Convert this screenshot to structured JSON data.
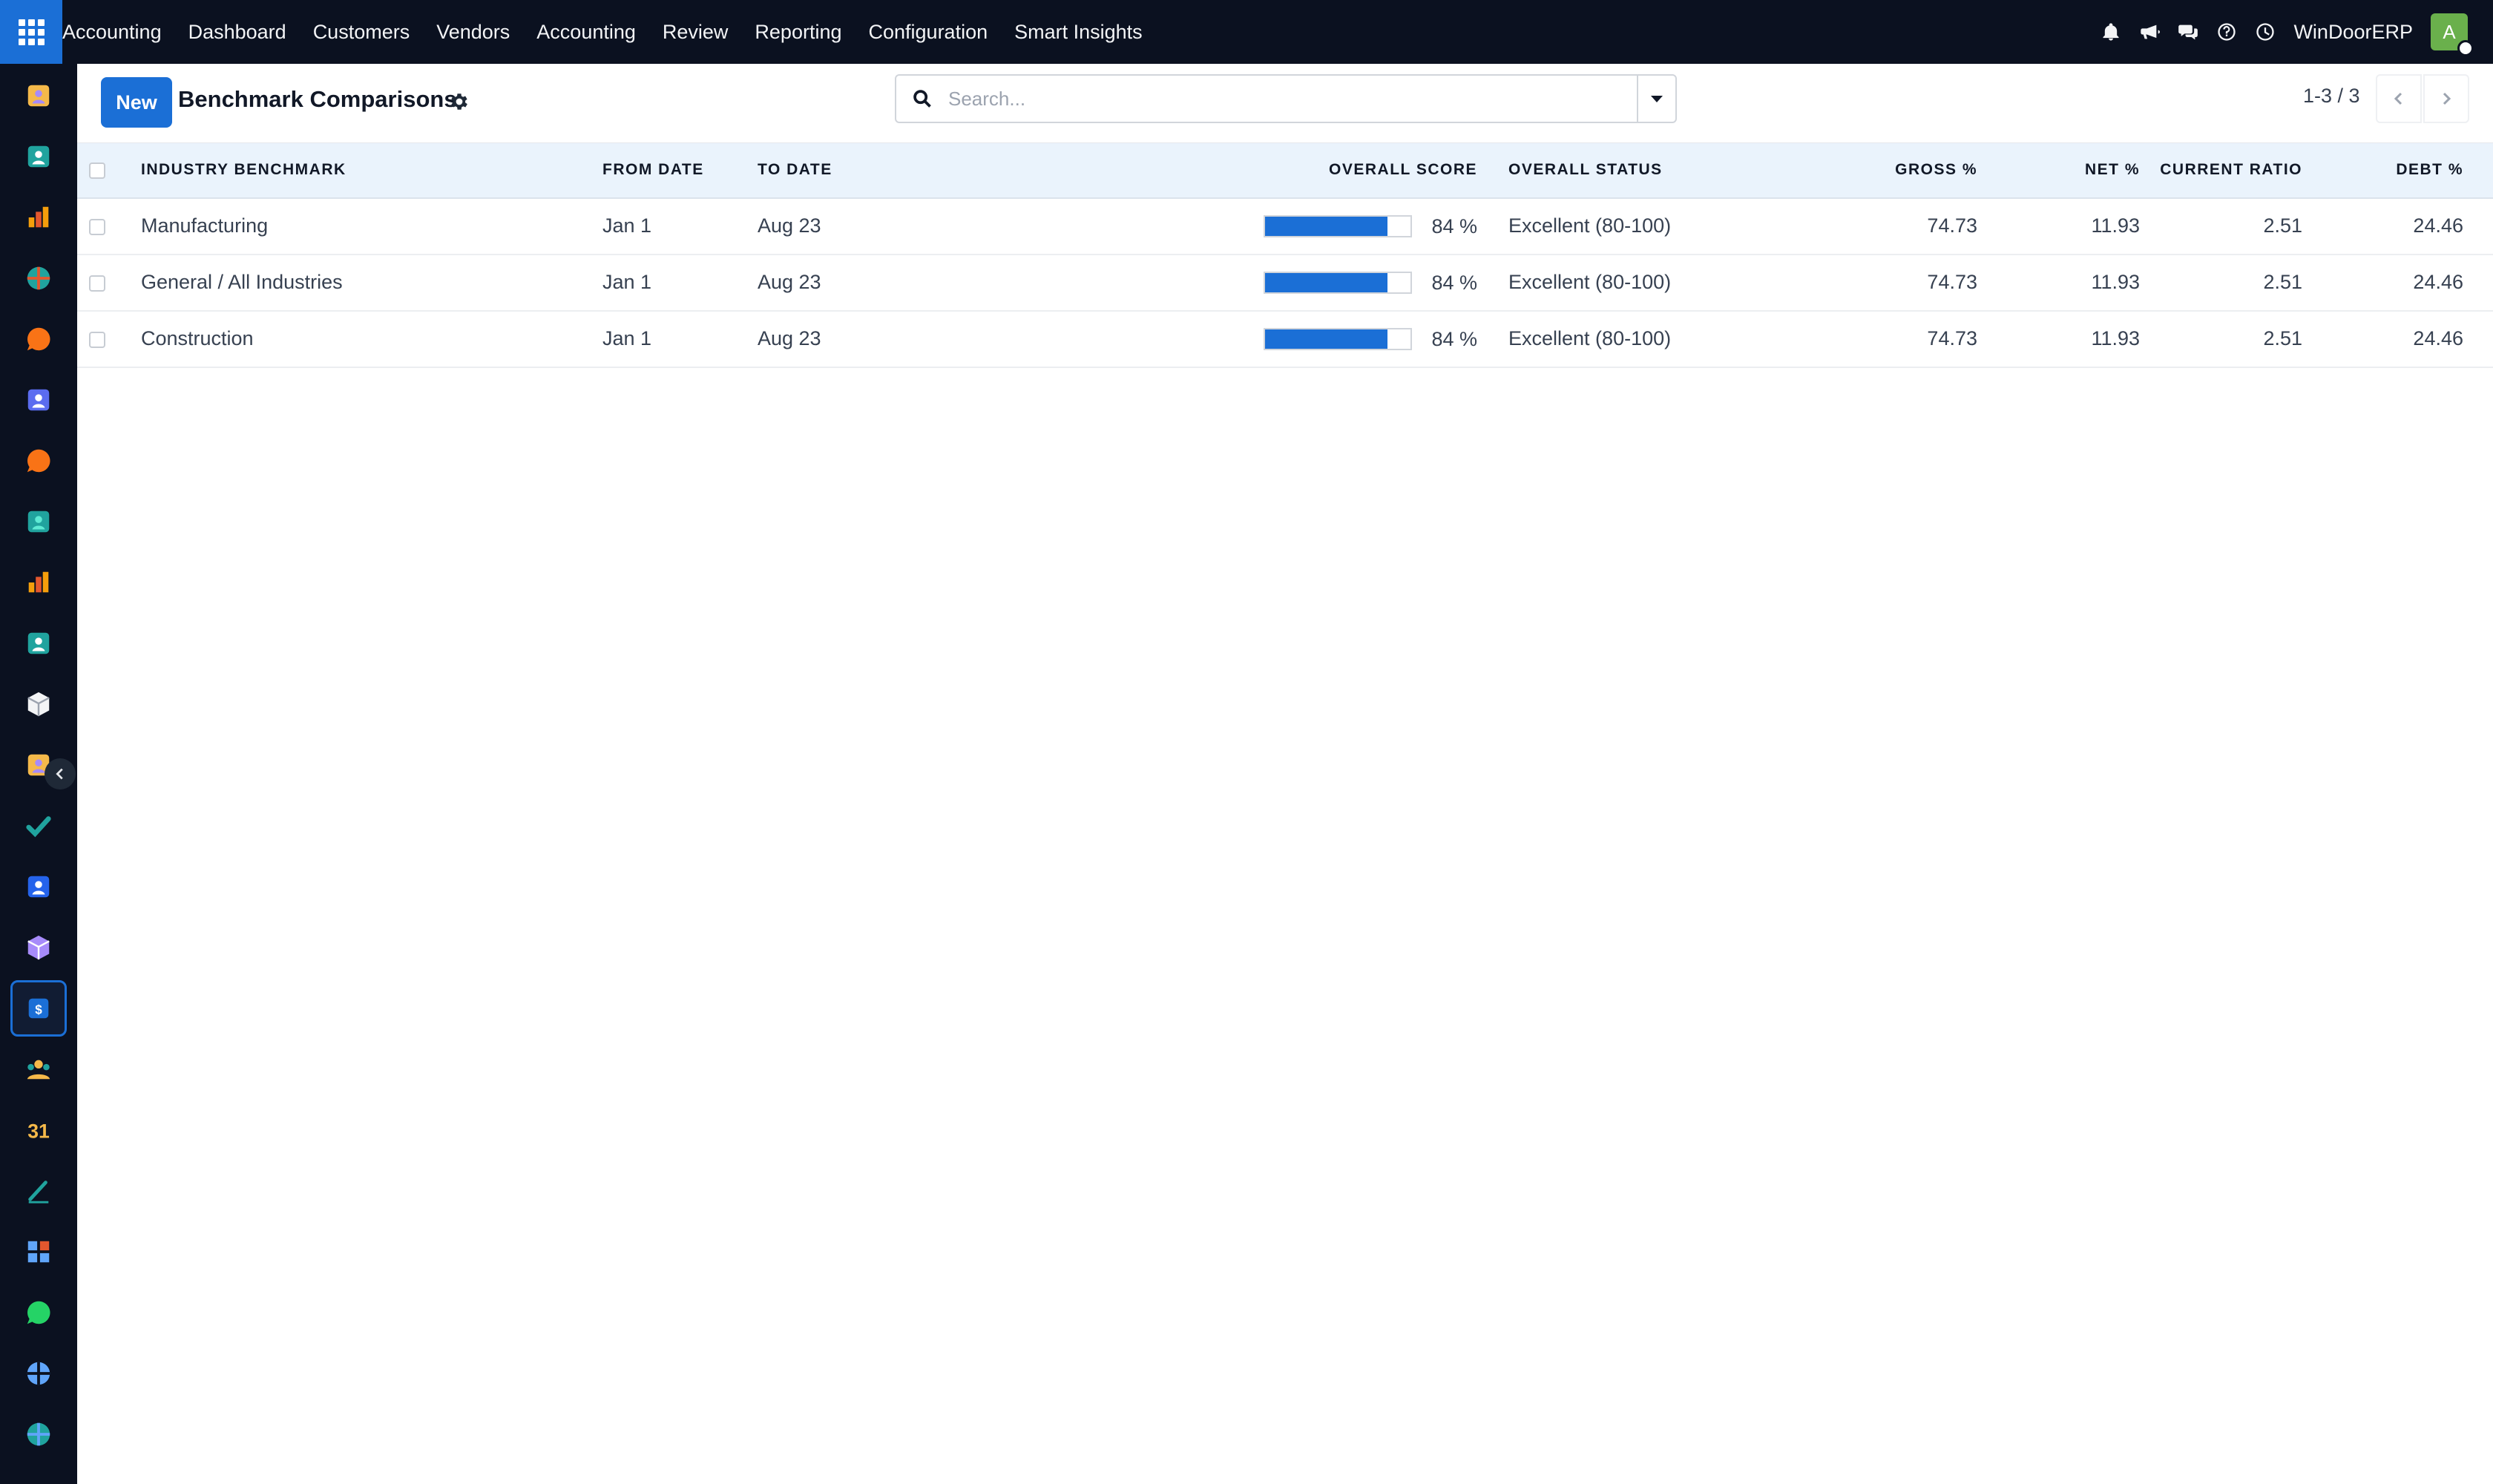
{
  "topbar": {
    "app_name": "Accounting",
    "menu": [
      "Dashboard",
      "Customers",
      "Vendors",
      "Accounting",
      "Review",
      "Reporting",
      "Configuration",
      "Smart Insights"
    ],
    "icons": [
      "bell-icon",
      "megaphone-icon",
      "chat-icon",
      "help-icon",
      "clock-icon"
    ],
    "company": "WinDoorERP",
    "avatar_letter": "A"
  },
  "dock": {
    "items": [
      "discuss-app-icon",
      "contacts-app-icon",
      "dashboards-app-icon",
      "pos-app-icon",
      "livechat-app-icon",
      "email-marketing-app-icon",
      "helpdesk-app-icon",
      "sms-app-icon",
      "sales-app-icon",
      "employees-app-icon",
      "inventory-app-icon",
      "crm-app-icon",
      "project-app-icon",
      "knowledge-app-icon",
      "manufacturing-app-icon",
      "accounting-app-icon",
      "team-app-icon",
      "calendar-app-icon",
      "sign-app-icon",
      "studio-app-icon",
      "whatsapp-app-icon",
      "fleet-app-icon",
      "website-app-icon"
    ],
    "active_index": 15
  },
  "control": {
    "new_label": "New",
    "title": "Benchmark Comparisons",
    "search_placeholder": "Search...",
    "pager_value": "1-3 / 3"
  },
  "table": {
    "headers": {
      "benchmark": "INDUSTRY BENCHMARK",
      "from": "FROM DATE",
      "to": "TO DATE",
      "score": "OVERALL SCORE",
      "status": "OVERALL STATUS",
      "gross": "GROSS %",
      "net": "NET %",
      "ratio": "CURRENT RATIO",
      "debt": "DEBT %"
    },
    "rows": [
      {
        "benchmark": "Manufacturing",
        "from": "Jan 1",
        "to": "Aug 23",
        "score": 84,
        "score_label": "84 %",
        "status": "Excellent (80-100)",
        "gross": "74.73",
        "net": "11.93",
        "ratio": "2.51",
        "debt": "24.46"
      },
      {
        "benchmark": "General / All Industries",
        "from": "Jan 1",
        "to": "Aug 23",
        "score": 84,
        "score_label": "84 %",
        "status": "Excellent (80-100)",
        "gross": "74.73",
        "net": "11.93",
        "ratio": "2.51",
        "debt": "24.46"
      },
      {
        "benchmark": "Construction",
        "from": "Jan 1",
        "to": "Aug 23",
        "score": 84,
        "score_label": "84 %",
        "status": "Excellent (80-100)",
        "gross": "74.73",
        "net": "11.93",
        "ratio": "2.51",
        "debt": "24.46"
      }
    ]
  },
  "colors": {
    "navbar": "#0b1120",
    "accent": "#1b6fd6",
    "header_row": "#eaf3fc",
    "avatar": "#6ab04c"
  }
}
